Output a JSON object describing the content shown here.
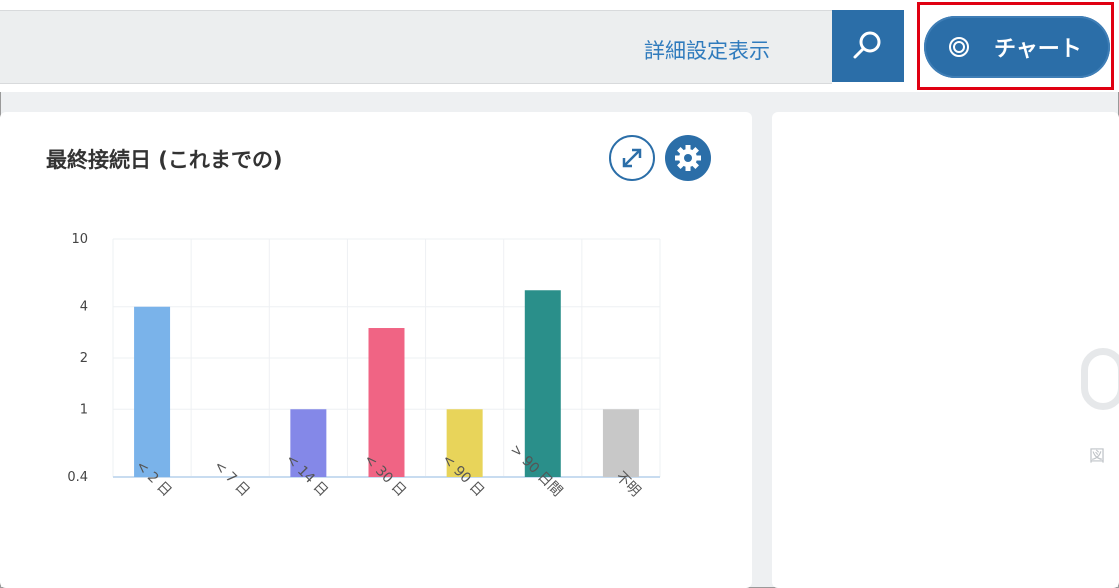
{
  "search": {
    "advanced_link": "詳細設定表示",
    "search_icon": "search-icon"
  },
  "chart_button": {
    "label": "チャート",
    "icon": "chart-target-icon",
    "color": "#2b6ea8"
  },
  "card": {
    "title": "最終接続日 (これまでの)",
    "expand_icon": "expand-icon",
    "settings_icon": "gear-icon"
  },
  "second_card": {
    "partial_text": "図"
  },
  "highlight_color": "#e00012",
  "chart_data": {
    "type": "bar",
    "title": "最終接続日 (これまでの)",
    "scale": "log",
    "yticks": [
      0.4,
      1,
      2,
      4,
      10
    ],
    "ylim": [
      0.4,
      10
    ],
    "categories": [
      "< 2 日",
      "< 7 日",
      "< 14 日",
      "< 30 日",
      "< 90 日",
      "> 90 日間",
      "不明"
    ],
    "values": [
      4,
      0,
      1,
      3,
      1,
      5,
      1
    ],
    "colors": [
      "#7ab3ea",
      "#ffffff",
      "#8488e8",
      "#f06484",
      "#e8d45a",
      "#2a8f8a",
      "#c8c8c8"
    ],
    "grid": true,
    "legend": "none"
  }
}
